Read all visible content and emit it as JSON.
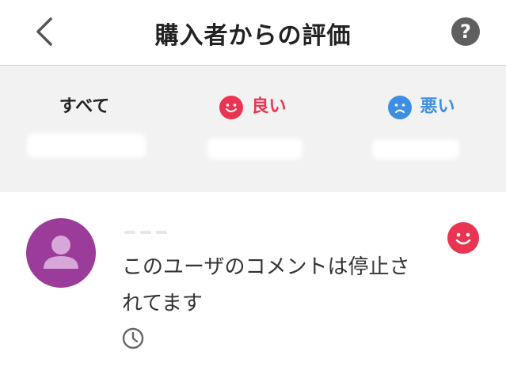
{
  "header": {
    "title": "購入者からの評価",
    "back_icon": "chevron-left-icon",
    "help_icon": "question-circle-icon",
    "help_glyph": "?"
  },
  "tabs": [
    {
      "label": "すべて",
      "icon": "",
      "color": "#222222"
    },
    {
      "label": "良い",
      "icon": "smile-face-icon",
      "color": "#ea3552"
    },
    {
      "label": "悪い",
      "icon": "frown-face-icon",
      "color": "#3d8fe3"
    }
  ],
  "selected_tab": "すべて",
  "review": {
    "text_line1": "このユーザのコメントは停止さ",
    "text_line2": "れてます",
    "rating_icon": "smile-face-icon",
    "time_icon": "clock-icon"
  },
  "colors": {
    "good": "#ea3552",
    "bad": "#3d8fe3",
    "avatar": "#9b3c9b",
    "tab_bg": "#f2f2f2"
  }
}
